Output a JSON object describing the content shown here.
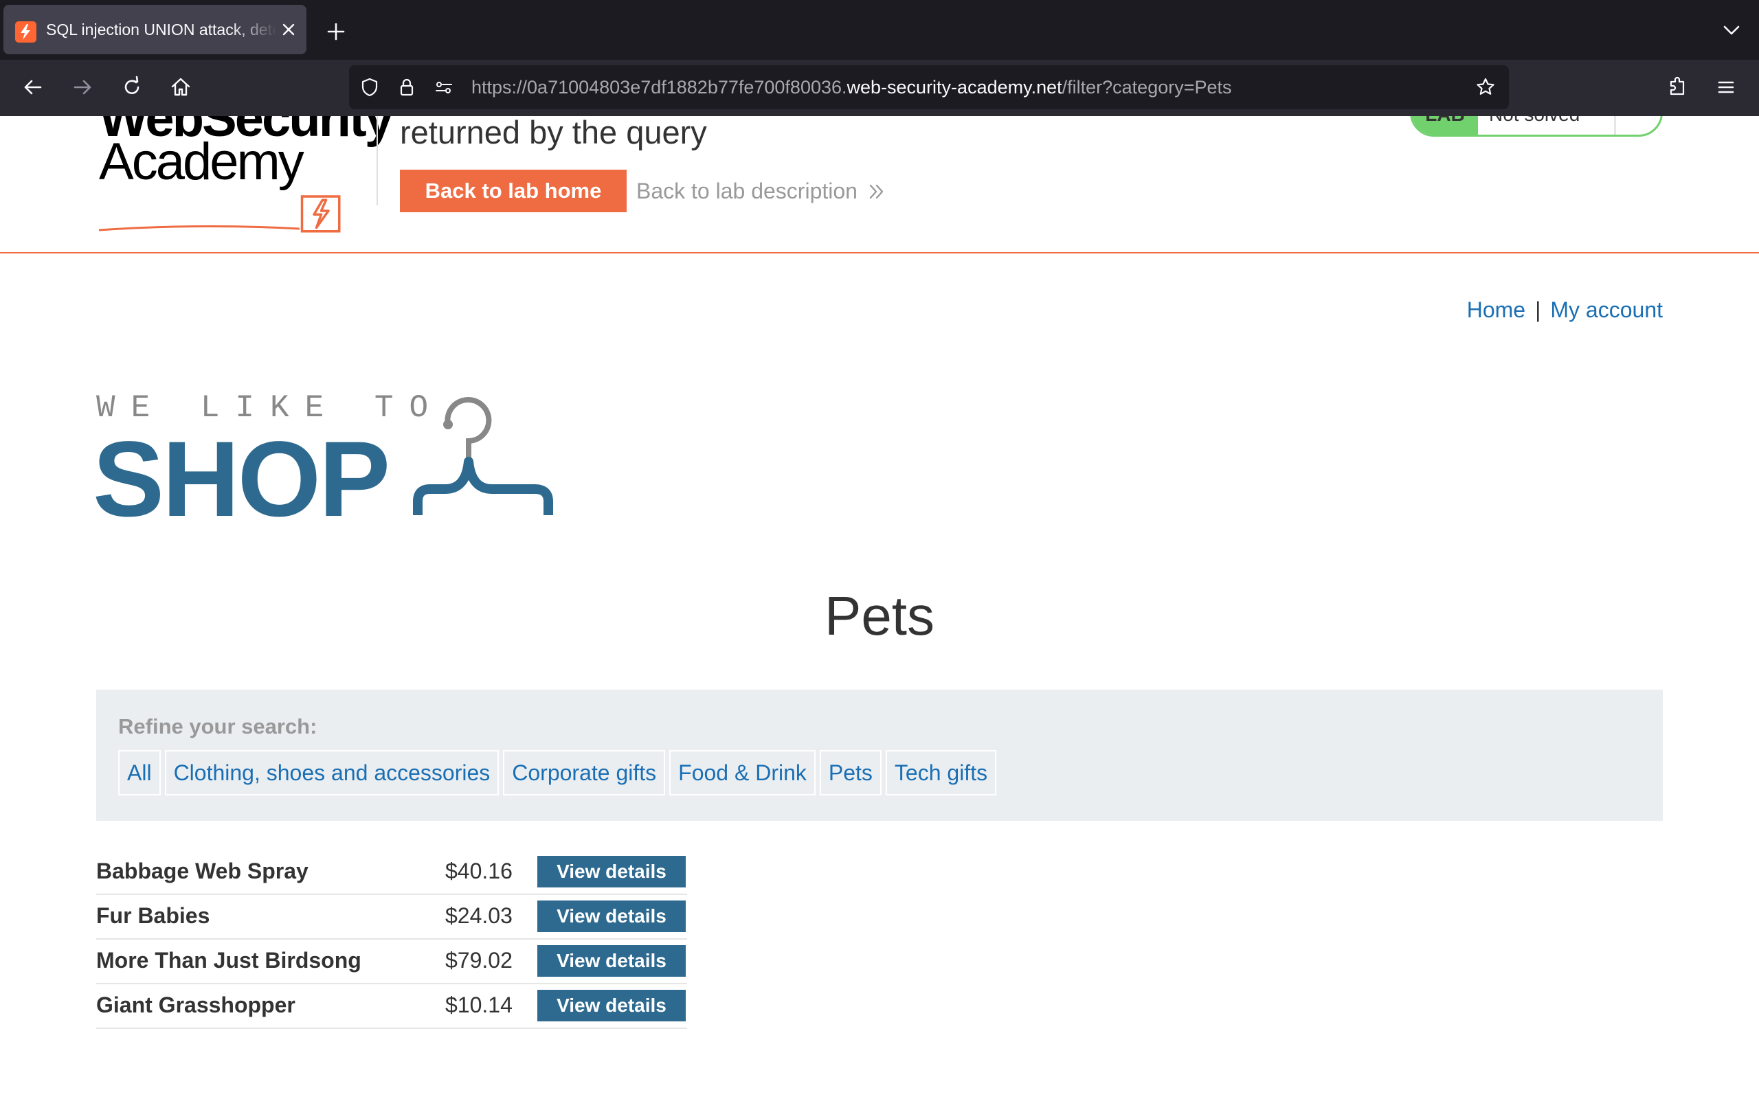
{
  "browser": {
    "tab_title": "SQL injection UNION attack, determining the number of columns",
    "url_prefix": "https://0a71004803e7df1882b77fe700f80036.",
    "url_host": "web-security-academy.net",
    "url_path": "/filter?category=Pets",
    "icons": [
      "portswigger-favicon",
      "close-icon",
      "plus-icon",
      "chevron-down-icon",
      "back-arrow-icon",
      "forward-arrow-icon",
      "reload-icon",
      "home-icon",
      "shield-icon",
      "lock-icon",
      "permissions-icon",
      "star-icon",
      "extensions-icon",
      "menu-icon"
    ]
  },
  "lab": {
    "logo_line1": "WebSecurity",
    "logo_line2": "Academy",
    "title": "returned by the query",
    "back_home": "Back to lab home",
    "back_description": "Back to lab description",
    "status_label": "LAB",
    "status_text": "Not solved",
    "accent_color": "#ef6c43"
  },
  "nav": {
    "home": "Home",
    "separator": "|",
    "account": "My account"
  },
  "shop_logo": {
    "tagline": "WE LIKE TO",
    "word": "SHOP"
  },
  "page": {
    "heading": "Pets"
  },
  "filter": {
    "label": "Refine your search:",
    "categories": [
      "All",
      "Clothing, shoes and accessories",
      "Corporate gifts",
      "Food & Drink",
      "Pets",
      "Tech gifts"
    ]
  },
  "products": [
    {
      "name": "Babbage Web Spray",
      "price": "$40.16",
      "button": "View details"
    },
    {
      "name": "Fur Babies",
      "price": "$24.03",
      "button": "View details"
    },
    {
      "name": "More Than Just Birdsong",
      "price": "$79.02",
      "button": "View details"
    },
    {
      "name": "Giant Grasshopper",
      "price": "$10.14",
      "button": "View details"
    }
  ]
}
